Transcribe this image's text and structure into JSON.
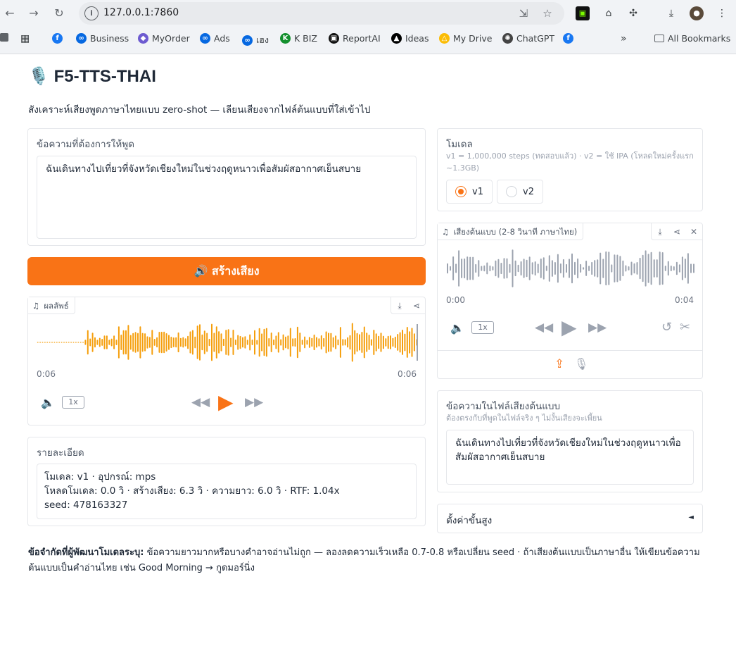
{
  "browser": {
    "url": "127.0.0.1:7860",
    "bookmarks": [
      {
        "label": "",
        "icon": "facebook-icon",
        "color": "#1877f2"
      },
      {
        "label": "Business",
        "icon": "meta-icon",
        "color": "#0668e1"
      },
      {
        "label": "MyOrder",
        "icon": "cube-icon",
        "color": "#6d5bd0"
      },
      {
        "label": "Ads",
        "icon": "meta-icon",
        "color": "#0668e1"
      },
      {
        "label": "เฮง",
        "icon": "meta-icon",
        "color": "#0668e1"
      },
      {
        "label": "K BIZ",
        "icon": "kbank-icon",
        "color": "#138f2d"
      },
      {
        "label": "ReportAI",
        "icon": "report-icon",
        "color": "#111111"
      },
      {
        "label": "Ideas",
        "icon": "ideas-icon",
        "color": "#000000"
      },
      {
        "label": "My Drive",
        "icon": "drive-icon",
        "color": "#fbbc04"
      },
      {
        "label": "ChatGPT",
        "icon": "chatgpt-icon",
        "color": "#444444"
      },
      {
        "label": "",
        "icon": "facebook-icon",
        "color": "#1877f2"
      }
    ],
    "all_bookmarks": "All Bookmarks"
  },
  "app": {
    "title": "F5-TTS-THAI",
    "title_icon": "🎙️",
    "subtitle": "สังเคราะห์เสียงพูดภาษาไทยแบบ zero-shot — เลียนเสียงจากไฟล์ต้นแบบที่ใส่เข้าไป"
  },
  "text_input": {
    "label": "ข้อความที่ต้องการให้พูด",
    "value": "ฉันเดินทางไปเที่ยวที่จังหวัดเชียงใหม่ในช่วงฤดูหนาวเพื่อสัมผัสอากาศเย็นสบาย"
  },
  "generate_button": {
    "label": "🔊 สร้างเสียง",
    "color": "#f97316"
  },
  "result_audio": {
    "label": "ผลลัพธ์",
    "time_current": "0:06",
    "time_total": "0:06",
    "speed": "1x",
    "played_fraction": 1.0,
    "wave_color": "#f59e0b"
  },
  "details": {
    "label": "รายละเอียด",
    "lines": [
      "โมเดล: v1 · อุปกรณ์: mps",
      "โหลดโมเดล: 0.0 วิ · สร้างเสียง: 6.3 วิ · ความยาว: 6.0 วิ · RTF: 1.04x",
      "seed: 478163327"
    ]
  },
  "model": {
    "label": "โมเดล",
    "hint_1": "v1 = 1,000,000 steps (ทดสอบแล้ว) · v2 = ใช้ IPA (โหลดใหม่ครั้งแรก",
    "hint_2": "~1.3GB)",
    "options": [
      "v1",
      "v2"
    ],
    "selected": "v1"
  },
  "ref_audio": {
    "label": "เสียงต้นแบบ (2-8 วินาที ภาษาไทย)",
    "time_current": "0:00",
    "time_total": "0:04",
    "speed": "1x",
    "played_fraction": 0.0,
    "wave_color": "#9ca3af"
  },
  "ref_text": {
    "label": "ข้อความในไฟล์เสียงต้นแบบ",
    "hint": "ต้องตรงกับที่พูดในไฟล์จริง ๆ ไม่งั้นเสียงจะเพี้ยน",
    "value": "ฉันเดินทางไปเที่ยวที่จังหวัดเชียงใหม่ในช่วงฤดูหนาวเพื่อสัมผัสอากาศเย็นสบาย"
  },
  "advanced": {
    "label": "ตั้งค่าขั้นสูง",
    "arrow": "◄"
  },
  "footer": {
    "bold": "ข้อจำกัดที่ผู้พัฒนาโมเดลระบุ:",
    "text": " ข้อความยาวมากหรือบางคำอาจอ่านไม่ถูก — ลองลดความเร็วเหลือ 0.7-0.8 หรือเปลี่ยน seed · ถ้าเสียงต้นแบบเป็นภาษาอื่น ให้เขียนข้อความต้นแบบเป็นคำอ่านไทย เช่น Good Morning → กูดมอร์นิ่ง"
  }
}
